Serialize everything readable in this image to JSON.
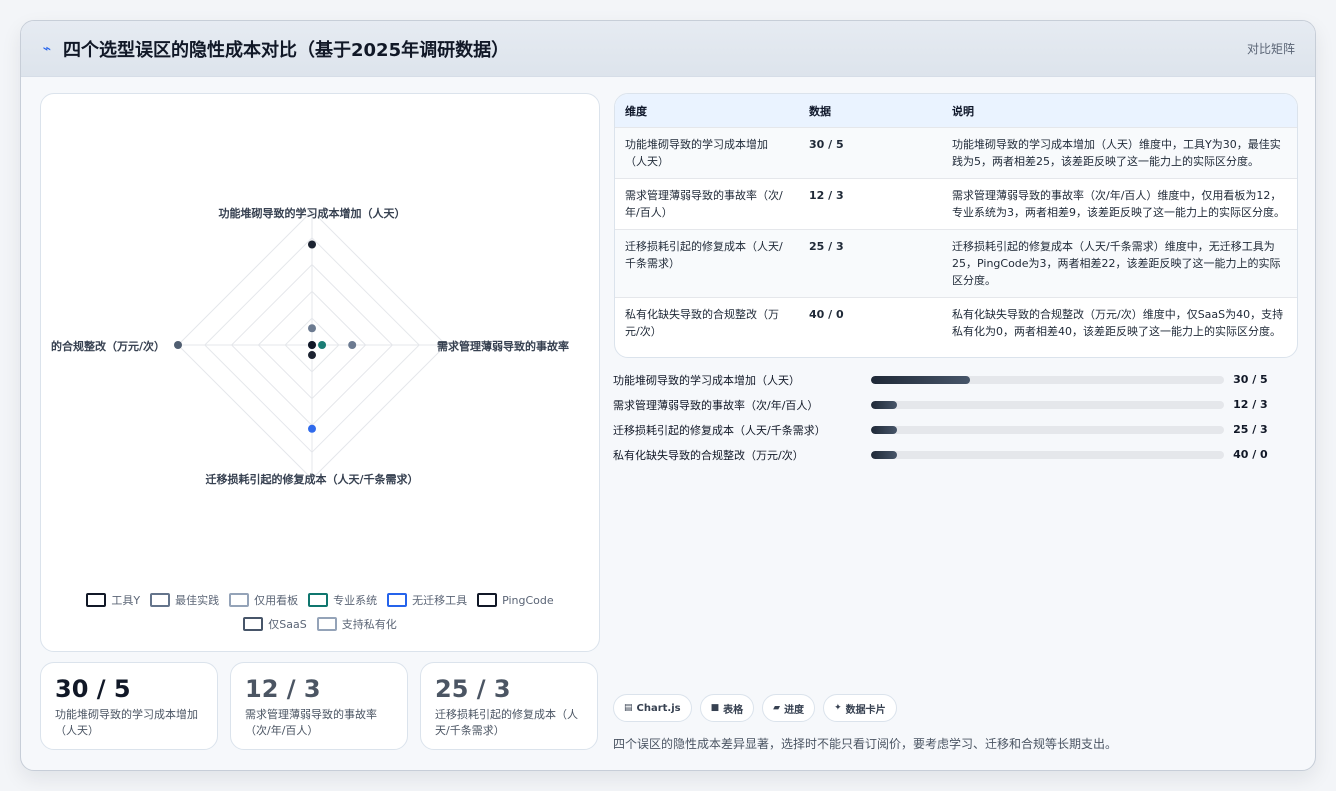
{
  "header": {
    "title": "四个选型误区的隐性成本对比（基于2025年调研数据）",
    "right_label": "对比矩阵",
    "icon": "trend-icon"
  },
  "chart_data": {
    "type": "radar",
    "axes": [
      "功能堆砌导致的学习成本增加（人天）",
      "需求管理薄弱导致的事故率（次/年/百人）",
      "迁移损耗引起的修复成本（人天/千条需求）",
      "私有化缺失导致的合规整改（万元/次）"
    ],
    "axis_labels_visible": [
      "功能堆砌导致的学习成本增加（人天）",
      "需求管理薄弱导致的事故率",
      "迁移损耗引起的修复成本（人天/千条需求）",
      "的合规整改（万元/次）"
    ],
    "grid": true,
    "legend_position": "bottom",
    "series": [
      {
        "name": "工具Y",
        "values": [
          30,
          0,
          0,
          0
        ],
        "color": "#111827"
      },
      {
        "name": "最佳实践",
        "values": [
          5,
          0,
          0,
          0
        ],
        "color": "#64748b"
      },
      {
        "name": "仅用看板",
        "values": [
          0,
          12,
          0,
          0
        ],
        "color": "#64748b"
      },
      {
        "name": "专业系统",
        "values": [
          0,
          3,
          0,
          0
        ],
        "color": "#0f766e"
      },
      {
        "name": "无迁移工具",
        "values": [
          0,
          0,
          25,
          0
        ],
        "color": "#2563eb"
      },
      {
        "name": "PingCode",
        "values": [
          0,
          0,
          3,
          0
        ],
        "color": "#111827"
      },
      {
        "name": "仅SaaS",
        "values": [
          0,
          0,
          0,
          40
        ],
        "color": "#475569"
      },
      {
        "name": "支持私有化",
        "values": [
          0,
          0,
          0,
          0
        ],
        "color": "#94a3b8"
      }
    ]
  },
  "metrics": [
    {
      "value": "30 / 5",
      "label": "功能堆砌导致的学习成本增加（人天）"
    },
    {
      "value": "12 / 3",
      "label": "需求管理薄弱导致的事故率（次/年/百人）"
    },
    {
      "value": "25 / 3",
      "label": "迁移损耗引起的修复成本（人天/千条需求）"
    }
  ],
  "table": {
    "headers": [
      "维度",
      "数据",
      "说明"
    ],
    "rows": [
      {
        "dimension": "功能堆砌导致的学习成本增加（人天）",
        "data": "30 / 5",
        "note": "功能堆砌导致的学习成本增加（人天）维度中，工具Y为30，最佳实践为5，两者相差25，该差距反映了这一能力上的实际区分度。"
      },
      {
        "dimension": "需求管理薄弱导致的事故率（次/年/百人）",
        "data": "12 / 3",
        "note": "需求管理薄弱导致的事故率（次/年/百人）维度中，仅用看板为12，专业系统为3，两者相差9，该差距反映了这一能力上的实际区分度。"
      },
      {
        "dimension": "迁移损耗引起的修复成本（人天/千条需求）",
        "data": "25 / 3",
        "note": "迁移损耗引起的修复成本（人天/千条需求）维度中，无迁移工具为25，PingCode为3，两者相差22，该差距反映了这一能力上的实际区分度。"
      },
      {
        "dimension": "私有化缺失导致的合规整改（万元/次）",
        "data": "40 / 0",
        "note": "私有化缺失导致的合规整改（万元/次）维度中，仅SaaS为40，支持私有化为0，两者相差40，该差距反映了这一能力上的实际区分度。"
      }
    ]
  },
  "bars": [
    {
      "label": "功能堆砌导致的学习成本增加（人天）",
      "value_text": "30 / 5",
      "progress": 0.28
    },
    {
      "label": "需求管理薄弱导致的事故率（次/年/百人）",
      "value_text": "12 / 3",
      "progress": 0.075
    },
    {
      "label": "迁移损耗引起的修复成本（人天/千条需求）",
      "value_text": "25 / 3",
      "progress": 0.075
    },
    {
      "label": "私有化缺失导致的合规整改（万元/次）",
      "value_text": "40 / 0",
      "progress": 0.075
    }
  ],
  "pills": [
    {
      "icon": "chart-icon",
      "label": "Chart.js"
    },
    {
      "icon": "table-icon",
      "label": "表格"
    },
    {
      "icon": "progress-icon",
      "label": "进度"
    },
    {
      "icon": "card-icon",
      "label": "数据卡片"
    }
  ],
  "footer_note": "四个误区的隐性成本差异显著，选择时不能只看订阅价，要考虑学习、迁移和合规等长期支出。"
}
